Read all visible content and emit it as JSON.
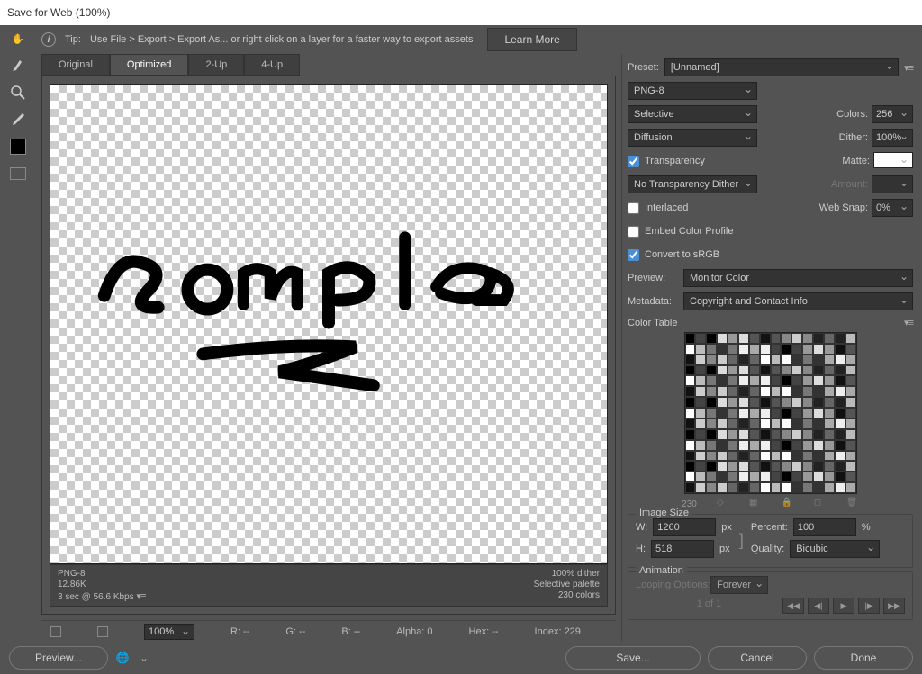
{
  "window": {
    "title": "Save for Web (100%)"
  },
  "tip": {
    "prefix": "Tip:",
    "text": "Use File > Export > Export As...   or right click on a layer for a faster way to export assets",
    "learn_more": "Learn More"
  },
  "tabs": {
    "original": "Original",
    "optimized": "Optimized",
    "two_up": "2-Up",
    "four_up": "4-Up"
  },
  "preview_meta": {
    "format": "PNG-8",
    "size": "12.86K",
    "speed": "3 sec @ 56.6 Kbps",
    "dither": "100% dither",
    "palette": "Selective palette",
    "colors": "230 colors"
  },
  "readouts": {
    "zoom": "100%",
    "r": "R: --",
    "g": "G: --",
    "b": "B: --",
    "alpha": "Alpha: 0",
    "hex": "Hex: --",
    "index": "Index: 229"
  },
  "settings": {
    "preset_label": "Preset:",
    "preset_value": "[Unnamed]",
    "format": "PNG-8",
    "reduction": "Selective",
    "dither_method": "Diffusion",
    "colors_label": "Colors:",
    "colors_value": "256",
    "dither_label": "Dither:",
    "dither_value": "100%",
    "transparency": "Transparency",
    "matte_label": "Matte:",
    "trans_dither": "No Transparency Dither",
    "amount_label": "Amount:",
    "interlaced": "Interlaced",
    "websnap_label": "Web Snap:",
    "websnap_value": "0%",
    "embed_profile": "Embed Color Profile",
    "convert_srgb": "Convert to sRGB",
    "preview_label": "Preview:",
    "preview_value": "Monitor Color",
    "metadata_label": "Metadata:",
    "metadata_value": "Copyright and Contact Info"
  },
  "color_table": {
    "title": "Color Table",
    "count": "230"
  },
  "image_size": {
    "title": "Image Size",
    "w_label": "W:",
    "w_value": "1260",
    "px": "px",
    "h_label": "H:",
    "h_value": "518",
    "percent_label": "Percent:",
    "percent_value": "100",
    "pct": "%",
    "quality_label": "Quality:",
    "quality_value": "Bicubic"
  },
  "animation": {
    "title": "Animation",
    "loop_label": "Looping Options:",
    "loop_value": "Forever",
    "frame": "1 of 1"
  },
  "footer": {
    "preview": "Preview...",
    "save": "Save...",
    "cancel": "Cancel",
    "done": "Done"
  }
}
